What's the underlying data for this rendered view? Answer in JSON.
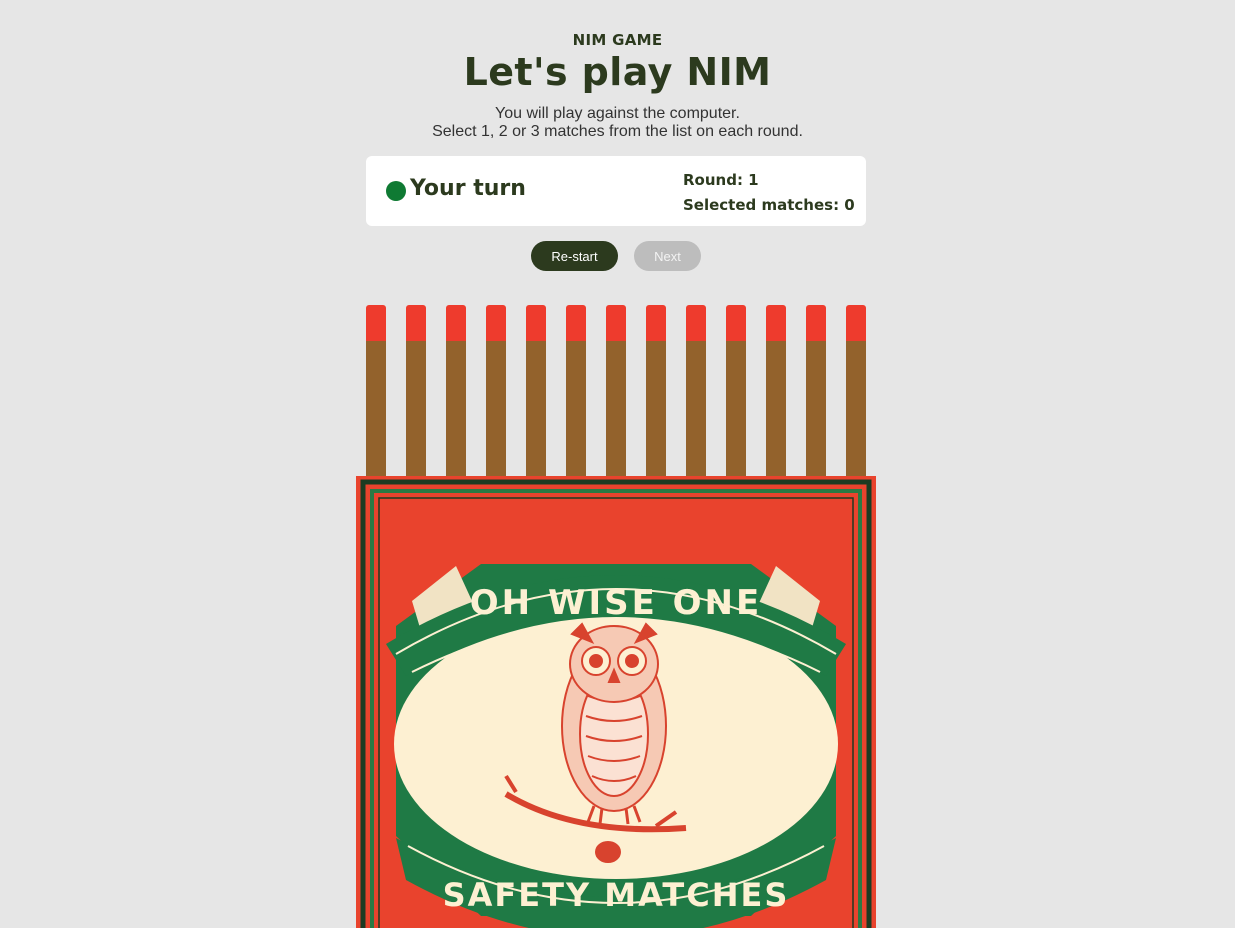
{
  "header": {
    "eyebrow": "NIM GAME",
    "title": "Let's play NIM",
    "intro_line1": "You will play against the computer.",
    "intro_line2": "Select 1, 2 or 3 matches from the list on each round."
  },
  "status": {
    "turn_label": "Your turn",
    "turn_indicator_color": "#0f7a33",
    "round_text": "Round: 1",
    "selected_text": "Selected matches: 0"
  },
  "controls": {
    "restart_label": "Re-start",
    "next_label": "Next"
  },
  "game": {
    "matches_remaining": 13,
    "match_head_color": "#ee3b2d",
    "match_stick_color": "#93622c"
  },
  "matchbox": {
    "label_top": "OH WISE ONE",
    "label_bottom": "SAFETY MATCHES",
    "box_color": "#e9432d",
    "banner_color": "#1f7a45",
    "panel_color": "#fdf0d2",
    "icon": "owl-illustration"
  }
}
